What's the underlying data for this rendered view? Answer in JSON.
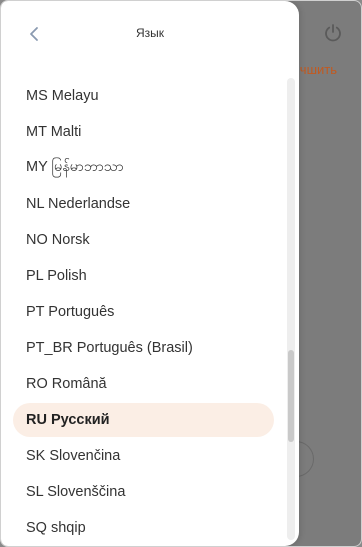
{
  "drawer": {
    "title": "Язык"
  },
  "background": {
    "link_text": "чшить"
  },
  "languages": [
    {
      "label": "MS Melayu"
    },
    {
      "label": "MT Malti"
    },
    {
      "label": "MY မြန်မာဘာသာ"
    },
    {
      "label": "NL Nederlandse"
    },
    {
      "label": "NO Norsk"
    },
    {
      "label": "PL Polish"
    },
    {
      "label": "PT Português"
    },
    {
      "label": "PT_BR Português (Brasil)"
    },
    {
      "label": "RO Română"
    },
    {
      "label": "RU Русский"
    },
    {
      "label": "SK Slovenčina"
    },
    {
      "label": "SL Slovenščina"
    },
    {
      "label": "SQ shqip"
    }
  ],
  "selected_index": 9,
  "colors": {
    "accent": "#c15a21",
    "selected_bg": "#fbeee5"
  },
  "icons": {
    "back": "chevron-left-icon",
    "power": "power-icon"
  }
}
